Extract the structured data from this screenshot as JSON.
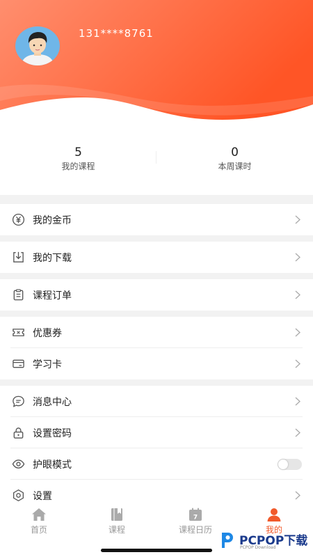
{
  "profile": {
    "phone": "131****8761"
  },
  "colors": {
    "accent": "#f15a2b",
    "header_start": "#ff8c6b",
    "header_end": "#ff5a2a"
  },
  "stats": [
    {
      "value": "5",
      "label": "我的课程"
    },
    {
      "value": "0",
      "label": "本周课时"
    }
  ],
  "menu": {
    "coins": "我的金币",
    "downloads": "我的下载",
    "orders": "课程订单",
    "coupons": "优惠券",
    "study_card": "学习卡",
    "messages": "消息中心",
    "password": "设置密码",
    "eye_mode": "护眼模式",
    "settings": "设置"
  },
  "eye_mode_enabled": false,
  "tabs": [
    {
      "label": "首页",
      "icon": "home-icon"
    },
    {
      "label": "课程",
      "icon": "book-icon"
    },
    {
      "label": "课程日历",
      "icon": "calendar-icon",
      "badge": "7"
    },
    {
      "label": "我的",
      "icon": "person-icon",
      "active": true
    }
  ],
  "watermark": {
    "brand": "PCPOP下载",
    "sub": "PCPOP Download"
  }
}
